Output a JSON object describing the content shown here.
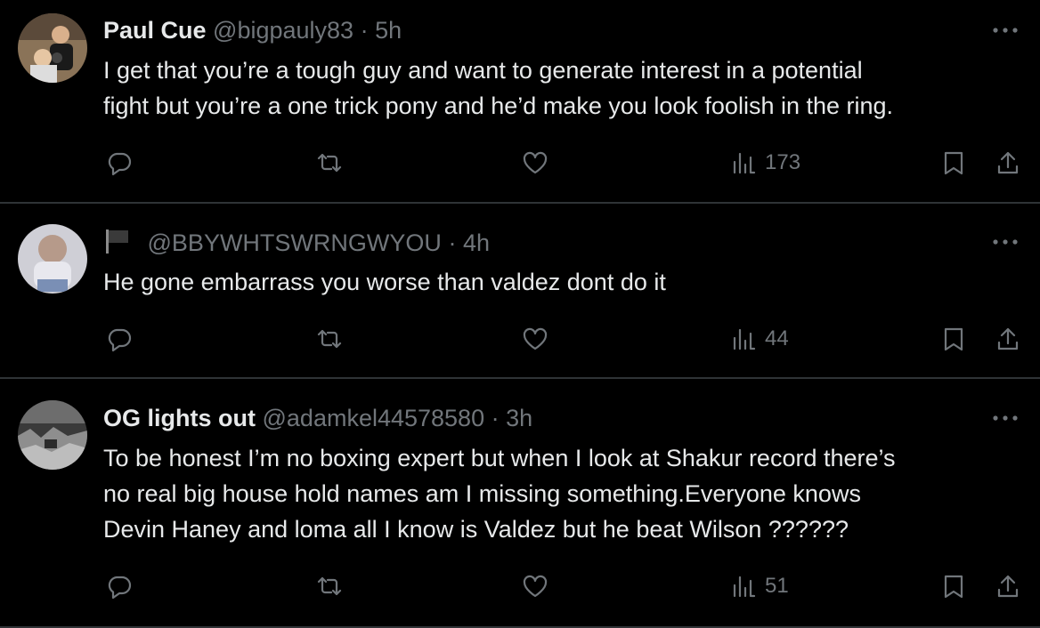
{
  "tweets": [
    {
      "name": "Paul Cue",
      "handle": "@bigpauly83",
      "separator": "·",
      "time": "5h",
      "text": "I get that you’re a tough guy and want to generate interest in a potential\nfight but you’re a one trick pony and he’d make you look foolish in the ring.",
      "views": "173"
    },
    {
      "name": "",
      "handle": "@BBYWHTSWRNGWYOU",
      "separator": "·",
      "time": "4h",
      "text": "He gone embarrass you worse than valdez dont do it",
      "views": "44"
    },
    {
      "name": "OG lights out",
      "handle": "@adamkel44578580",
      "separator": "·",
      "time": "3h",
      "text": "To be honest I’m no boxing expert but when I look at Shakur record there’s\nno real big house hold names am I missing something.Everyone knows\nDevin Haney and loma all I know is Valdez but he beat Wilson ??????",
      "views": "51"
    }
  ],
  "icons": {
    "more": "more-icon",
    "reply": "reply-icon",
    "retweet": "retweet-icon",
    "like": "like-icon",
    "views": "views-icon",
    "bookmark": "bookmark-icon",
    "share": "share-icon",
    "flag": "flag-icon"
  },
  "colors": {
    "background": "#000000",
    "text": "#e7e9ea",
    "secondary": "#71767b",
    "divider": "#2f3336"
  }
}
